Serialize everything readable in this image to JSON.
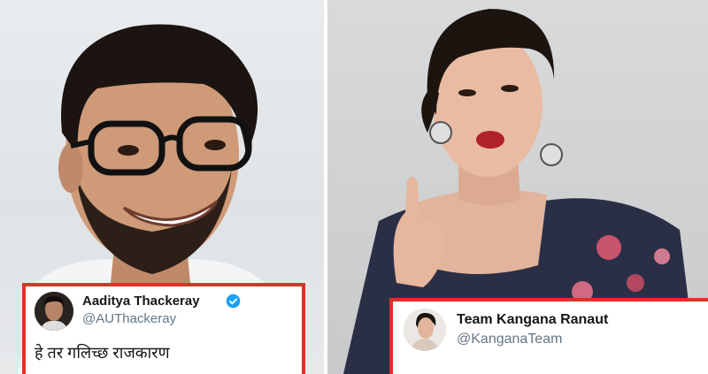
{
  "left_tweet": {
    "name": "Aaditya Thackeray",
    "handle": "@AUThackeray",
    "text": "हे तर गलिच्छ राजकारण",
    "verified": true,
    "border_color": "#e0302a",
    "verified_color": "#1da1f2"
  },
  "right_tweet": {
    "name": "Team Kangana Ranaut",
    "handle": "@KanganaTeam",
    "border_color": "#e0302a"
  },
  "icons": [
    "verified-badge-icon"
  ]
}
